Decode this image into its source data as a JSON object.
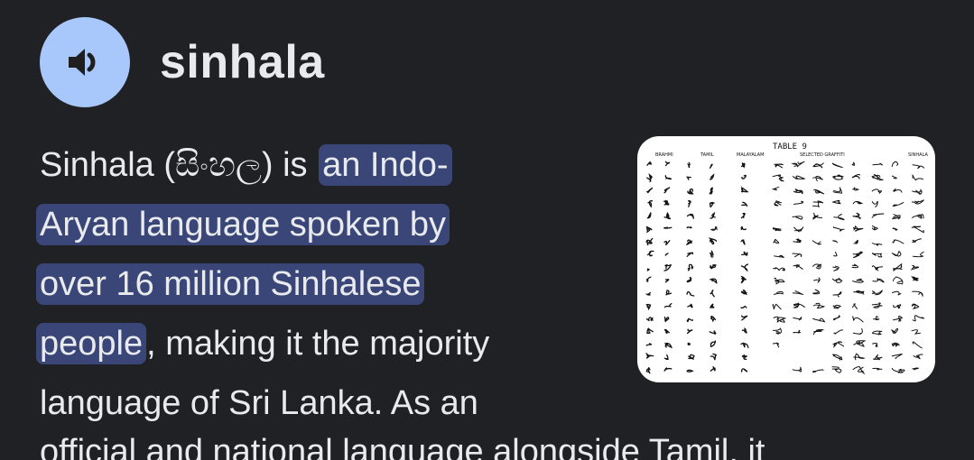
{
  "header": {
    "title": "sinhala",
    "speaker_icon": "speaker-icon"
  },
  "description": {
    "line1_plain": "Sinhala (සිංහල) is ",
    "line1_highlight": "an Indo-",
    "line2_highlight": "Aryan language spoken by",
    "line3_highlight": "over 16 million Sinhalese",
    "line4_highlight": "people",
    "line4_plain": ", making it the majority",
    "line5_plain": "language of Sri Lanka. As an",
    "line6_partial": "official and national language alongside Tamil, it"
  },
  "thumbnail": {
    "table_title": "TABLE 9",
    "col_brahmi": "BRAHMI",
    "col_tamil": "TAMIL",
    "col_malayalam": "MALAYALAM",
    "col_selected": "SELECTED GRAFFITI",
    "col_sinhala": "SINHALA"
  },
  "colors": {
    "background": "#202124",
    "text": "#e8eaed",
    "highlight": "#394677",
    "speaker_bg": "#a8c7fa"
  }
}
